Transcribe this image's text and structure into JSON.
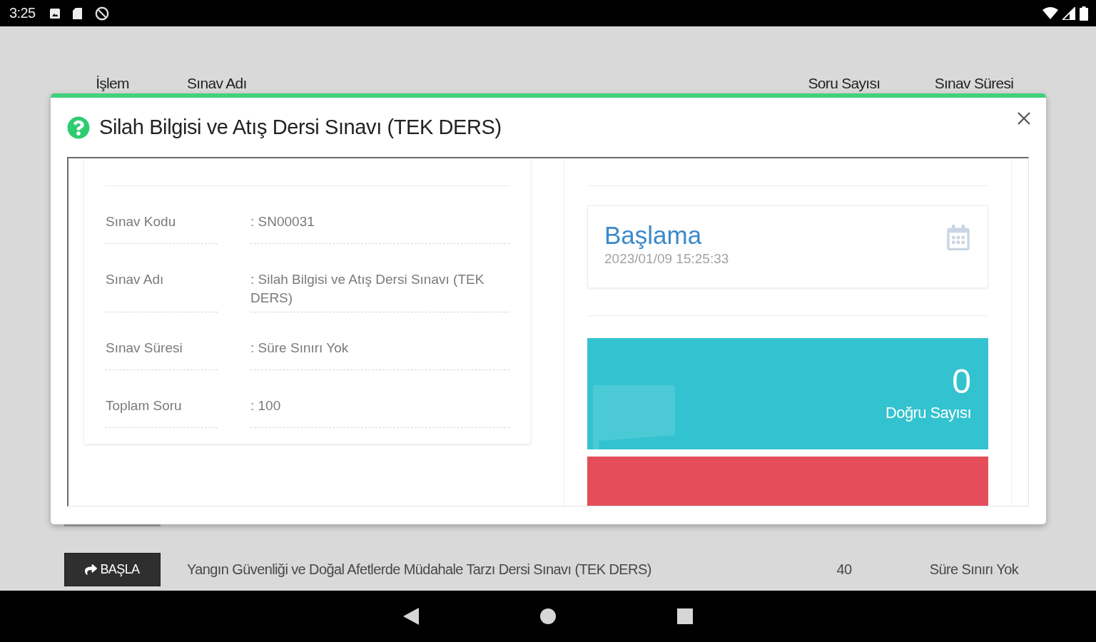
{
  "status_bar": {
    "time": "3:25"
  },
  "table": {
    "columns": [
      "İşlem",
      "Sınav Adı",
      "Soru Sayısı",
      "Sınav Süresi"
    ],
    "rows": [
      {
        "action": "BAŞLA",
        "exam_name": "Yangın Güvenliği ve Doğal Afetlerde Müdahale Tarzı Dersi Sınavı (TEK DERS)",
        "question_count": "40",
        "duration": "Süre Sınırı Yok"
      }
    ]
  },
  "dialog": {
    "title": "Silah Bilgisi ve Atış Dersi Sınavı (TEK DERS)",
    "details": [
      {
        "label": "Sınav Kodu",
        "value": ": SN00031"
      },
      {
        "label": "Sınav Adı",
        "value": ": Silah Bilgisi ve Atış Dersi Sınavı (TEK DERS)"
      },
      {
        "label": "Sınav Süresi",
        "value": ": Süre Sınırı Yok"
      },
      {
        "label": "Toplam Soru",
        "value": ": 100"
      }
    ],
    "start": {
      "label": "Başlama",
      "value": "2023/01/09 15:25:33"
    },
    "stats": [
      {
        "value": "0",
        "label": "Doğru Sayısı",
        "color": "#33c3d0"
      },
      {
        "color": "#e44e5a"
      }
    ]
  }
}
